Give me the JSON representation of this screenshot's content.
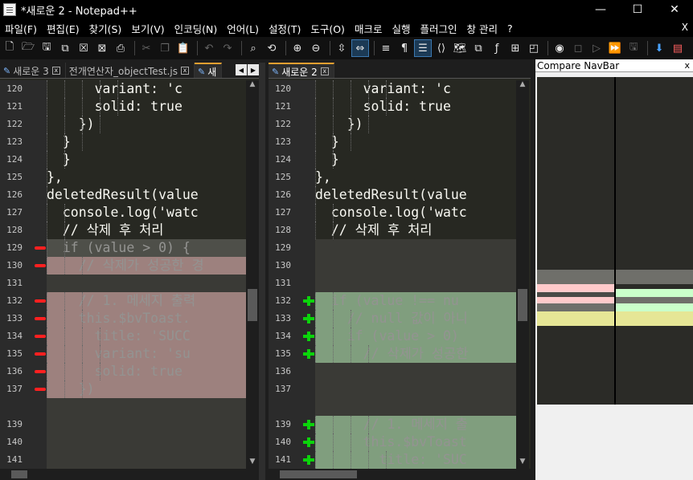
{
  "window": {
    "title": "*새로운 2 - Notepad++",
    "minimize": "—",
    "maximize": "☐",
    "close": "✕"
  },
  "menu": [
    "파일(F)",
    "편집(E)",
    "찾기(S)",
    "보기(V)",
    "인코딩(N)",
    "언어(L)",
    "설정(T)",
    "도구(O)",
    "매크로",
    "실행",
    "플러그인",
    "창 관리",
    "?"
  ],
  "menu_close": "X",
  "toolbar_icons": [
    "new-file",
    "open-file",
    "save",
    "save-all",
    "close",
    "close-all",
    "print",
    "cut",
    "copy",
    "paste",
    "undo",
    "redo",
    "find",
    "replace",
    "zoom-in",
    "zoom-out",
    "sync-vertical",
    "sync-horizontal",
    "word-wrap",
    "show-all-chars",
    "indent-guide",
    "udl",
    "doc-map",
    "doc-list",
    "function-list",
    "folder-workspace",
    "monitor",
    "record-macro",
    "stop-macro",
    "play-macro",
    "run-macro-multiple",
    "save-macro",
    "compare-navbar",
    "compare-panel"
  ],
  "left_panel": {
    "tabs": [
      {
        "label": "새로운 3",
        "active": false
      },
      {
        "label": "전개연산자_objectTest.js",
        "active": false
      },
      {
        "label": "새",
        "active": true
      }
    ],
    "lines": [
      {
        "num": "120",
        "code": "      variant: 'c",
        "bg": "none",
        "marker": "",
        "guides": 5
      },
      {
        "num": "121",
        "code": "      solid: true",
        "bg": "none",
        "marker": "",
        "guides": 5
      },
      {
        "num": "122",
        "code": "    })",
        "bg": "none",
        "marker": "",
        "guides": 4
      },
      {
        "num": "123",
        "code": "  }",
        "bg": "none",
        "marker": "",
        "guides": 3
      },
      {
        "num": "124",
        "code": "  }",
        "bg": "none",
        "marker": "",
        "guides": 2
      },
      {
        "num": "125",
        "code": "},",
        "bg": "none",
        "marker": "",
        "guides": 1
      },
      {
        "num": "126",
        "code": "deletedResult(value",
        "bg": "none",
        "marker": "",
        "guides": 1
      },
      {
        "num": "127",
        "code": "  console.log('watc",
        "bg": "none",
        "marker": "",
        "guides": 2
      },
      {
        "num": "128",
        "code": "  // 삭제 후 처리",
        "bg": "none",
        "marker": "",
        "guides": 2
      },
      {
        "num": "129",
        "code": "  if (value > 0) {",
        "bg": "mov",
        "marker": "minus",
        "guides": 2
      },
      {
        "num": "130",
        "code": "    // 삭제가 성공한 경",
        "bg": "del",
        "marker": "minus",
        "guides": 3
      },
      {
        "num": "131",
        "code": "",
        "bg": "gap",
        "marker": "",
        "guides": 0
      },
      {
        "num": "132",
        "code": "    // 1. 메세지 출력",
        "bg": "del",
        "marker": "minus",
        "guides": 3
      },
      {
        "num": "133",
        "code": "    this.$bvToast.",
        "bg": "del",
        "marker": "minus",
        "guides": 3
      },
      {
        "num": "134",
        "code": "      title: 'SUCC",
        "bg": "del",
        "marker": "minus",
        "guides": 4
      },
      {
        "num": "135",
        "code": "      variant: 'su",
        "bg": "del",
        "marker": "minus",
        "guides": 4
      },
      {
        "num": "136",
        "code": "      solid: true",
        "bg": "del",
        "marker": "minus",
        "guides": 4
      },
      {
        "num": "137",
        "code": "    })",
        "bg": "del",
        "marker": "minus",
        "guides": 3
      },
      {
        "num": "",
        "code": "",
        "bg": "gap",
        "marker": "",
        "guides": 0
      },
      {
        "num": "139",
        "code": "",
        "bg": "gap",
        "marker": "",
        "guides": 0
      },
      {
        "num": "140",
        "code": "",
        "bg": "gap",
        "marker": "",
        "guides": 0
      },
      {
        "num": "141",
        "code": "",
        "bg": "gap",
        "marker": "",
        "guides": 0
      }
    ]
  },
  "right_panel": {
    "tabs": [
      {
        "label": "새로운 2",
        "active": true
      }
    ],
    "lines": [
      {
        "num": "120",
        "code": "      variant: 'c",
        "bg": "none",
        "marker": "",
        "guides": 5
      },
      {
        "num": "121",
        "code": "      solid: true",
        "bg": "none",
        "marker": "",
        "guides": 5
      },
      {
        "num": "122",
        "code": "    })",
        "bg": "none",
        "marker": "",
        "guides": 4
      },
      {
        "num": "123",
        "code": "  }",
        "bg": "none",
        "marker": "",
        "guides": 3
      },
      {
        "num": "124",
        "code": "  }",
        "bg": "none",
        "marker": "",
        "guides": 2
      },
      {
        "num": "125",
        "code": "},",
        "bg": "none",
        "marker": "",
        "guides": 1
      },
      {
        "num": "126",
        "code": "deletedResult(value",
        "bg": "none",
        "marker": "",
        "guides": 1
      },
      {
        "num": "127",
        "code": "  console.log('watc",
        "bg": "none",
        "marker": "",
        "guides": 2
      },
      {
        "num": "128",
        "code": "  // 삭제 후 처리",
        "bg": "none",
        "marker": "",
        "guides": 2
      },
      {
        "num": "129",
        "code": "",
        "bg": "gap",
        "marker": "",
        "guides": 0
      },
      {
        "num": "130",
        "code": "",
        "bg": "gap",
        "marker": "",
        "guides": 0
      },
      {
        "num": "131",
        "code": "",
        "bg": "gap",
        "marker": "",
        "guides": 0
      },
      {
        "num": "132",
        "code": "  if (value !== nu",
        "bg": "add",
        "marker": "plus",
        "guides": 2
      },
      {
        "num": "133",
        "code": "    // null 값이 아니",
        "bg": "add",
        "marker": "plus",
        "guides": 3
      },
      {
        "num": "134",
        "code": "    if (value > 0)",
        "bg": "add",
        "marker": "plus",
        "guides": 3
      },
      {
        "num": "135",
        "code": "      // 삭제가 성공한",
        "bg": "add",
        "marker": "plus",
        "guides": 4
      },
      {
        "num": "136",
        "code": "",
        "bg": "gap",
        "marker": "",
        "guides": 0
      },
      {
        "num": "137",
        "code": "",
        "bg": "gap",
        "marker": "",
        "guides": 0
      },
      {
        "num": "",
        "code": "",
        "bg": "gap",
        "marker": "",
        "guides": 0
      },
      {
        "num": "139",
        "code": "      // 1. 메세지 출",
        "bg": "add",
        "marker": "plus",
        "guides": 4
      },
      {
        "num": "140",
        "code": "      this.$bvToast",
        "bg": "add",
        "marker": "plus",
        "guides": 4
      },
      {
        "num": "141",
        "code": "        title: 'SUC",
        "bg": "add",
        "marker": "plus",
        "guides": 5
      }
    ]
  },
  "navbar": {
    "title": "Compare NavBar",
    "close": "x"
  },
  "colors": {
    "deleted": "#ffcaca",
    "added": "#caffca",
    "moved": "#6f6f6a",
    "gap": "#3a3a36",
    "changed": "#e6e696"
  }
}
